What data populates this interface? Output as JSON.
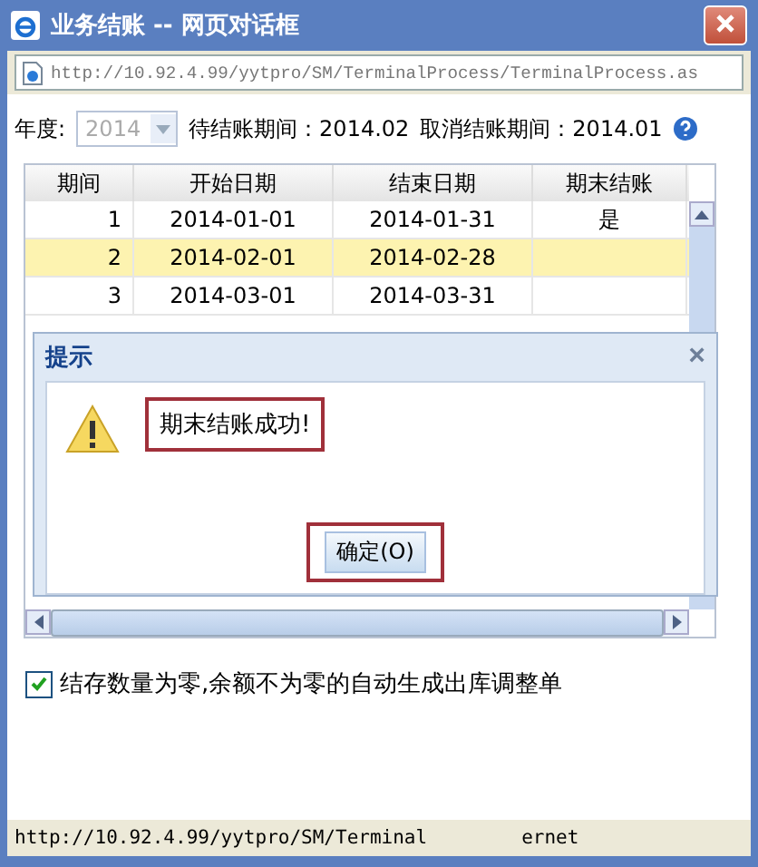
{
  "window": {
    "title": "业务结账 -- 网页对话框",
    "address": "http://10.92.4.99/yytpro/SM/TerminalProcess/TerminalProcess.as"
  },
  "filter": {
    "year_label": "年度:",
    "year": "2014",
    "year_disabled": true,
    "pending_period": "待结账期间：2014.02",
    "cancel_period": "取消结账期间：2014.01"
  },
  "table": {
    "columns": [
      "期间",
      "开始日期",
      "结束日期",
      "期末结账"
    ],
    "rows": [
      {
        "period": "1",
        "start": "2014-01-01",
        "end": "2014-01-31",
        "closed": "是",
        "selected": false
      },
      {
        "period": "2",
        "start": "2014-02-01",
        "end": "2014-02-28",
        "selected": true
      },
      {
        "period": "3",
        "start": "2014-03-01",
        "end": "2014-03-31",
        "selected": false
      }
    ]
  },
  "dialog": {
    "title": "提示",
    "close": "×",
    "message": "期末结账成功!",
    "message_annotated": true,
    "ok_button": "确定(O)",
    "ok_annotated": true
  },
  "option": {
    "label": "结存数量为零,余额不为零的自动生成出库调整单",
    "checked": true
  },
  "status_bar": {
    "url": "http://10.92.4.99/yytpro/SM/Terminal",
    "zone": "ernet"
  }
}
